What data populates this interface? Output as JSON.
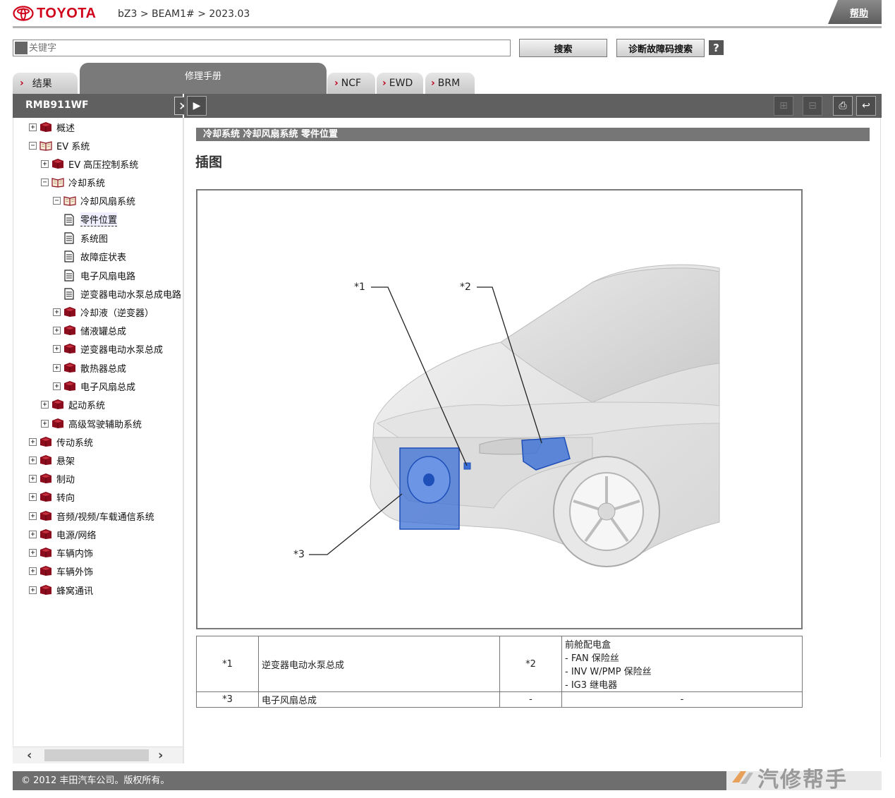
{
  "header": {
    "brand": "TOYOTA",
    "breadcrumb": "bZ3 > BEAM1# > 2023.03",
    "help_label": "帮助"
  },
  "search": {
    "placeholder": "关键字",
    "search_label": "搜索",
    "dtc_label": "诊断故障码搜索",
    "help_icon": "?"
  },
  "tabs": [
    {
      "label": "结果"
    },
    {
      "label": "修理手册"
    },
    {
      "label": "NCF"
    },
    {
      "label": "EWD"
    },
    {
      "label": "BRM"
    }
  ],
  "left_panel": {
    "title": "RMB911WF",
    "tree": [
      {
        "label": "概述"
      },
      {
        "label": "EV 系统"
      },
      {
        "label": "EV 高压控制系统"
      },
      {
        "label": "冷却系统"
      },
      {
        "label": "冷却风扇系统"
      },
      {
        "label": "零件位置"
      },
      {
        "label": "系统图"
      },
      {
        "label": "故障症状表"
      },
      {
        "label": "电子风扇电路"
      },
      {
        "label": "逆变器电动水泵总成电路"
      },
      {
        "label": "冷却液（逆变器）"
      },
      {
        "label": "储液罐总成"
      },
      {
        "label": "逆变器电动水泵总成"
      },
      {
        "label": "散热器总成"
      },
      {
        "label": "电子风扇总成"
      },
      {
        "label": "起动系统"
      },
      {
        "label": "高级驾驶辅助系统"
      },
      {
        "label": "传动系统"
      },
      {
        "label": "悬架"
      },
      {
        "label": "制动"
      },
      {
        "label": "转向"
      },
      {
        "label": "音频/视频/车载通信系统"
      },
      {
        "label": "电源/网络"
      },
      {
        "label": "车辆内饰"
      },
      {
        "label": "车辆外饰"
      },
      {
        "label": "蜂窝通讯"
      }
    ]
  },
  "content": {
    "section_path": "冷却系统  冷却风扇系统  零件位置",
    "illustration_title": "插图",
    "callouts": [
      "*1",
      "*2",
      "*3"
    ],
    "table": [
      {
        "k1": "*1",
        "v1": "逆变器电动水泵总成",
        "k2": "*2",
        "v2_lines": [
          "前舱配电盒",
          "- FAN 保险丝",
          "- INV W/PMP 保险丝",
          "- IG3 继电器"
        ]
      },
      {
        "k1": "*3",
        "v1": "电子风扇总成",
        "k2": "-",
        "v2": "-"
      }
    ]
  },
  "footer": {
    "copyright": "© 2012 丰田汽车公司。版权所有。",
    "watermark": "汽修帮手"
  },
  "colors": {
    "brand_red": "#d0021b",
    "toolbar_gray": "#606060",
    "highlight_blue": "#3b6fd6"
  }
}
